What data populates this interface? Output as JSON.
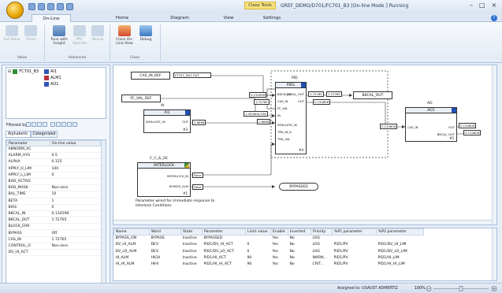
{
  "window": {
    "title": "GREF_DEMO/D701/FC701_B3 [On-line Mode ] Running",
    "context_tab": "Class Tools",
    "controls": [
      "–",
      "□",
      "×"
    ]
  },
  "tabs": [
    {
      "label": "On-Line",
      "active": true
    },
    {
      "label": "Home",
      "active": false
    },
    {
      "label": "Diagram",
      "active": false
    },
    {
      "label": "View",
      "active": false
    },
    {
      "label": "Settings",
      "active": false
    }
  ],
  "ribbon": {
    "groups": [
      {
        "label": "Value",
        "buttons": [
          {
            "label": "Set Value",
            "enabled": false
          },
          {
            "label": "Trend",
            "enabled": false
          }
        ]
      },
      {
        "label": "Advanced",
        "buttons": [
          {
            "label": "Tune with Insight",
            "enabled": true
          },
          {
            "label": "PPC Operate",
            "enabled": false
          },
          {
            "label": "Neural",
            "enabled": false
          }
        ]
      },
      {
        "label": "Close",
        "buttons": [
          {
            "label": "Close On-Line View",
            "enabled": true
          },
          {
            "label": "Debug",
            "enabled": true
          }
        ]
      }
    ]
  },
  "tree": {
    "root": "FC701_B3",
    "children": [
      "AI1",
      "ALM1",
      "AO1"
    ]
  },
  "filter": {
    "label": "Filtered by:"
  },
  "props_tabs": [
    "Alphabetic",
    "Categorized"
  ],
  "props": {
    "headers": [
      "Parameter",
      "On-line value"
    ],
    "rows": [
      [
        "ABNORM_AC",
        ""
      ],
      [
        "ALARM_HYS",
        "0.5"
      ],
      [
        "ALPHA",
        "0.125"
      ],
      [
        "APPLY_H_LIM",
        "100"
      ],
      [
        "APPLY_L_LIM",
        "0"
      ],
      [
        "BAD_ACTIVE",
        ""
      ],
      [
        "BAD_MASK",
        "Non-zero"
      ],
      [
        "BAL_TIME",
        "10"
      ],
      [
        "BETA",
        "1"
      ],
      [
        "BIAS",
        "0"
      ],
      [
        "BKCAL_IN",
        "0.134599"
      ],
      [
        "BKCAL_OUT",
        "1.72765"
      ],
      [
        "BLOCK_ERR",
        ""
      ],
      [
        "BYPASS",
        "Off"
      ],
      [
        "CAS_IN",
        "1.72765"
      ],
      [
        "CONTROL_O",
        "Non-zero"
      ],
      [
        "DV_HI_ACT",
        ""
      ]
    ]
  },
  "diagram": {
    "tags": {
      "cas_in_ref": "CAS_IN_REF",
      "cas_in_ref_val": "FT701_DX1.OUT",
      "ff_val_ref": "FF_VAL_REF",
      "bkcal_out": "BKCAL_OUT",
      "bypassed": "BYPASSED"
    },
    "pid": {
      "type": "PID",
      "name": "PID1",
      "number": "#4",
      "inputs": [
        "BKCAL_IN",
        "CAS_IN",
        "FF_VAL",
        "IN",
        "SIMULATE_IN",
        "TRK_IN_D",
        "TRK_VAL"
      ],
      "outputs": [
        "BKCAL_OUT",
        "OUT"
      ],
      "values": {
        "bkcal_in": "0.134599",
        "cas_in": "1.72765",
        "ff_val": "1.45280e-038",
        "in": "1.6866",
        "bkcal_out": "1.72765",
        "out": "0.134606"
      }
    },
    "ai": {
      "type": "AI",
      "name": "AI1",
      "number": "#3",
      "pins_in": [
        "SIMULATE_IN"
      ],
      "pins_out": [
        "OUT"
      ],
      "out_value": "1.6866"
    },
    "ao": {
      "type": "AO",
      "name": "AO1",
      "number": "#5",
      "pins_in": [
        "CAS_IN"
      ],
      "pins_out": [
        "OUT",
        "BKCAL_OUT"
      ],
      "values": {
        "cas_in": "0.134606",
        "out": "0.134606",
        "bkcal_out": "0.134606"
      },
      "pid_out_value": "1.72765"
    },
    "interlock": {
      "type": "C_C_&_SS",
      "name": "INTERLOCK",
      "number": "#1",
      "pins_out": [
        "INTERLOCK_IN",
        "BYPASS_ALM"
      ],
      "values": [
        "False",
        "False"
      ],
      "comment": "Parameter wired for immediate response to Interlock Conditions"
    }
  },
  "alarms": {
    "headers": [
      "Name",
      "Word",
      "State",
      "Parameter",
      "Limit value",
      "Enable",
      "Inverted",
      "Priority",
      "%P1 parameter",
      "%P2 parameter"
    ],
    "rows": [
      [
        "BYPASS_ON",
        "BYPASS",
        "Inactive",
        "BYPASSED",
        "",
        "Yes",
        "No",
        "LOG",
        "",
        ""
      ],
      [
        "DV_HI_ALM",
        "DEV",
        "Inactive",
        "PID1/DV_HI_ACT",
        "0",
        "Yes",
        "No",
        "LOG",
        "PID1/PV",
        "PID1/DV_HI_LIM"
      ],
      [
        "DV_LO_ALM",
        "DEV",
        "Inactive",
        "PID1/DV_LO_ACT",
        "0",
        "Yes",
        "No",
        "LOG",
        "PID1/PV",
        "PID1/DV_LO_LIM"
      ],
      [
        "HI_ALM",
        "HIGH",
        "Inactive",
        "PID1/HI_ACT",
        "90",
        "Yes",
        "No",
        "WARN...",
        "PID1/PV",
        "PID1/HI_LIM"
      ],
      [
        "HI_HI_ALM",
        "HIHI",
        "Inactive",
        "PID1/HI_HI_ACT",
        "90",
        "Yes",
        "No",
        "CRIT...",
        "PID1/PV",
        "PID1/HI_HI_LIM"
      ]
    ]
  },
  "status": {
    "assigned": "Assigned to: USAUST ADMERTIZ",
    "zoom": "100%"
  },
  "colors": {
    "accent": "#1f4fb3",
    "context_tab": "#f7e27a"
  }
}
